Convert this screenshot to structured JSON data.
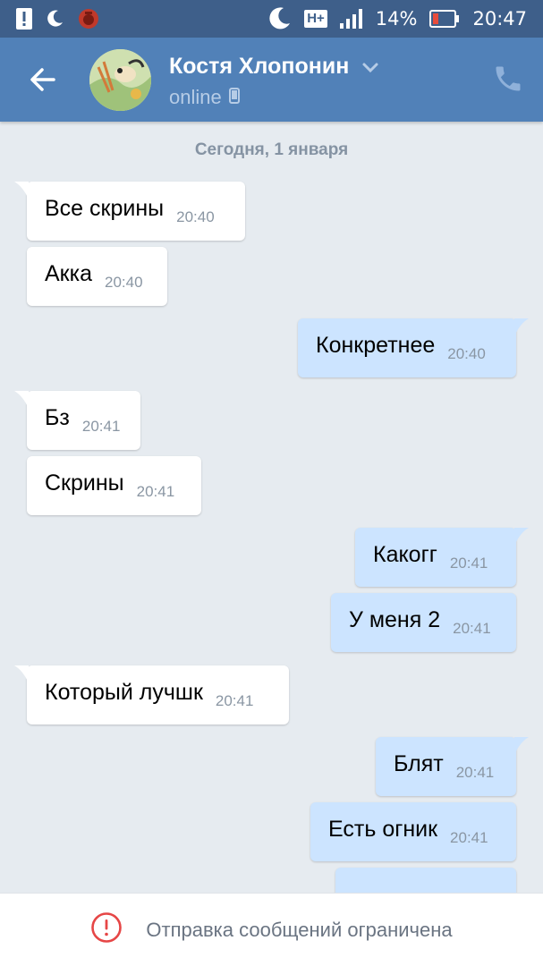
{
  "status_bar": {
    "battery_percent": "14%",
    "time": "20:47",
    "network": "H+",
    "icons_left": [
      "alert-icon",
      "moon-icon",
      "app-notification-icon"
    ],
    "icons_right": [
      "moon-icon",
      "hplus-icon",
      "signal-icon",
      "battery-icon"
    ]
  },
  "header": {
    "contact_name": "Костя Хлопонин",
    "presence": "online",
    "icons": [
      "back-arrow-icon",
      "chevron-down-icon",
      "phone-icon",
      "mobile-device-icon"
    ]
  },
  "chat": {
    "date_separator": "Сегодня, 1 января",
    "messages": [
      {
        "dir": "in",
        "text": "Все скрины",
        "time": "20:40"
      },
      {
        "dir": "in",
        "text": "Акка",
        "time": "20:40"
      },
      {
        "dir": "out",
        "text": "Конкретнее",
        "time": "20:40"
      },
      {
        "dir": "in",
        "text": "Бз",
        "time": "20:41"
      },
      {
        "dir": "in",
        "text": "Скрины",
        "time": "20:41"
      },
      {
        "dir": "out",
        "text": "Какогг",
        "time": "20:41"
      },
      {
        "dir": "out",
        "text": "У меня 2",
        "time": "20:41"
      },
      {
        "dir": "in",
        "text": "Который лучшк",
        "time": "20:41"
      },
      {
        "dir": "out",
        "text": "Блят",
        "time": "20:41"
      },
      {
        "dir": "out",
        "text": "Есть огник",
        "time": "20:41"
      }
    ]
  },
  "footer": {
    "restriction_text": "Отправка сообщений ограничена",
    "icon": "warning-circle-icon"
  },
  "colors": {
    "status_bar": "#3e5f8a",
    "header": "#5181b8",
    "chat_bg": "#e6ebf0",
    "incoming_bubble": "#ffffff",
    "outgoing_bubble": "#cce4ff",
    "warning": "#e64646"
  }
}
